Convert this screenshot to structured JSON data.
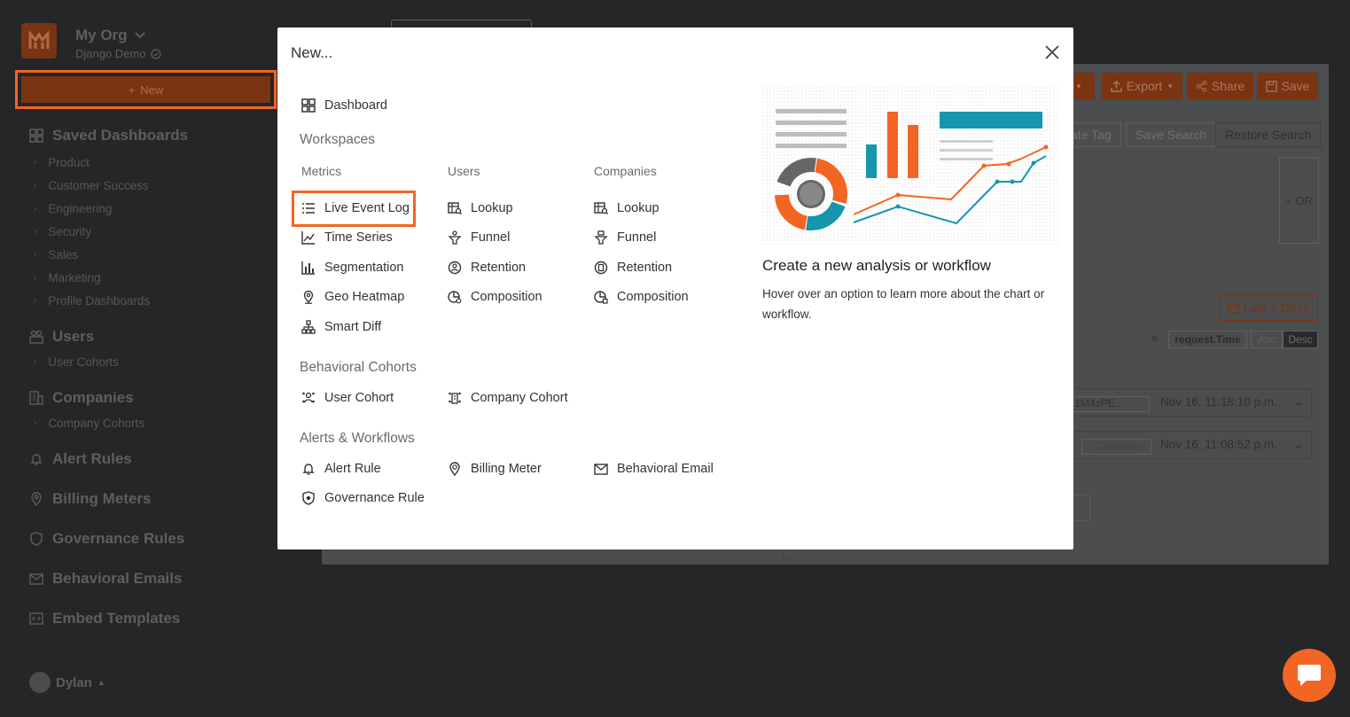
{
  "org": {
    "name": "My Org",
    "subtitle": "Django Demo"
  },
  "sidebar": {
    "new_label": "New",
    "sections": [
      {
        "label": "Saved Dashboards",
        "icon": "dashboard-icon",
        "children": [
          "Product",
          "Customer Success",
          "Engineering",
          "Security",
          "Sales",
          "Marketing",
          "Profile Dashboards"
        ]
      },
      {
        "label": "Users",
        "icon": "users-icon",
        "children": [
          "User Cohorts"
        ]
      },
      {
        "label": "Companies",
        "icon": "building-icon",
        "children": [
          "Company Cohorts"
        ]
      },
      {
        "label": "Alert Rules",
        "icon": "bell-icon",
        "children": []
      },
      {
        "label": "Billing Meters",
        "icon": "pin-icon",
        "children": []
      },
      {
        "label": "Governance Rules",
        "icon": "shield-icon",
        "children": []
      },
      {
        "label": "Behavioral Emails",
        "icon": "mail-icon",
        "children": []
      },
      {
        "label": "Embed Templates",
        "icon": "embed-icon",
        "children": []
      }
    ],
    "user_name": "Dylan"
  },
  "background": {
    "export_label": "Export",
    "share_label": "Share",
    "save_label": "Save",
    "create_tag_label": "ate Tag",
    "save_search_label": "Save Search",
    "restore_search_label": "Restore Search",
    "or_label": "+ OR",
    "last_days_label": "Last 7 Days",
    "sort_field": "request.Time",
    "asc_label": "Asc",
    "desc_label": "Desc",
    "row1_chip": "b_1M4zPE...",
    "row1_time": "Nov 16, 11:18:10 p.m.",
    "row2_chip": "Company",
    "row2_time": "Nov 16, 11:08:52 p.m."
  },
  "modal": {
    "title": "New...",
    "dashboard_label": "Dashboard",
    "workspaces_heading": "Workspaces",
    "columns": {
      "metrics": "Metrics",
      "users": "Users",
      "companies": "Companies"
    },
    "metrics": [
      "Live Event Log",
      "Time Series",
      "Segmentation",
      "Geo Heatmap",
      "Smart Diff"
    ],
    "users": [
      "Lookup",
      "Funnel",
      "Retention",
      "Composition"
    ],
    "companies": [
      "Lookup",
      "Funnel",
      "Retention",
      "Composition"
    ],
    "cohorts_heading": "Behavioral Cohorts",
    "cohorts": [
      "User Cohort",
      "Company Cohort"
    ],
    "alerts_heading": "Alerts & Workflows",
    "alerts": [
      "Alert Rule",
      "Billing Meter",
      "Behavioral Email",
      "Governance Rule"
    ],
    "right_title": "Create a new analysis or workflow",
    "right_desc": "Hover over an option to learn more about the chart or workflow."
  },
  "colors": {
    "accent": "#f26522",
    "teal": "#1596ad",
    "overlay": "#252627"
  }
}
